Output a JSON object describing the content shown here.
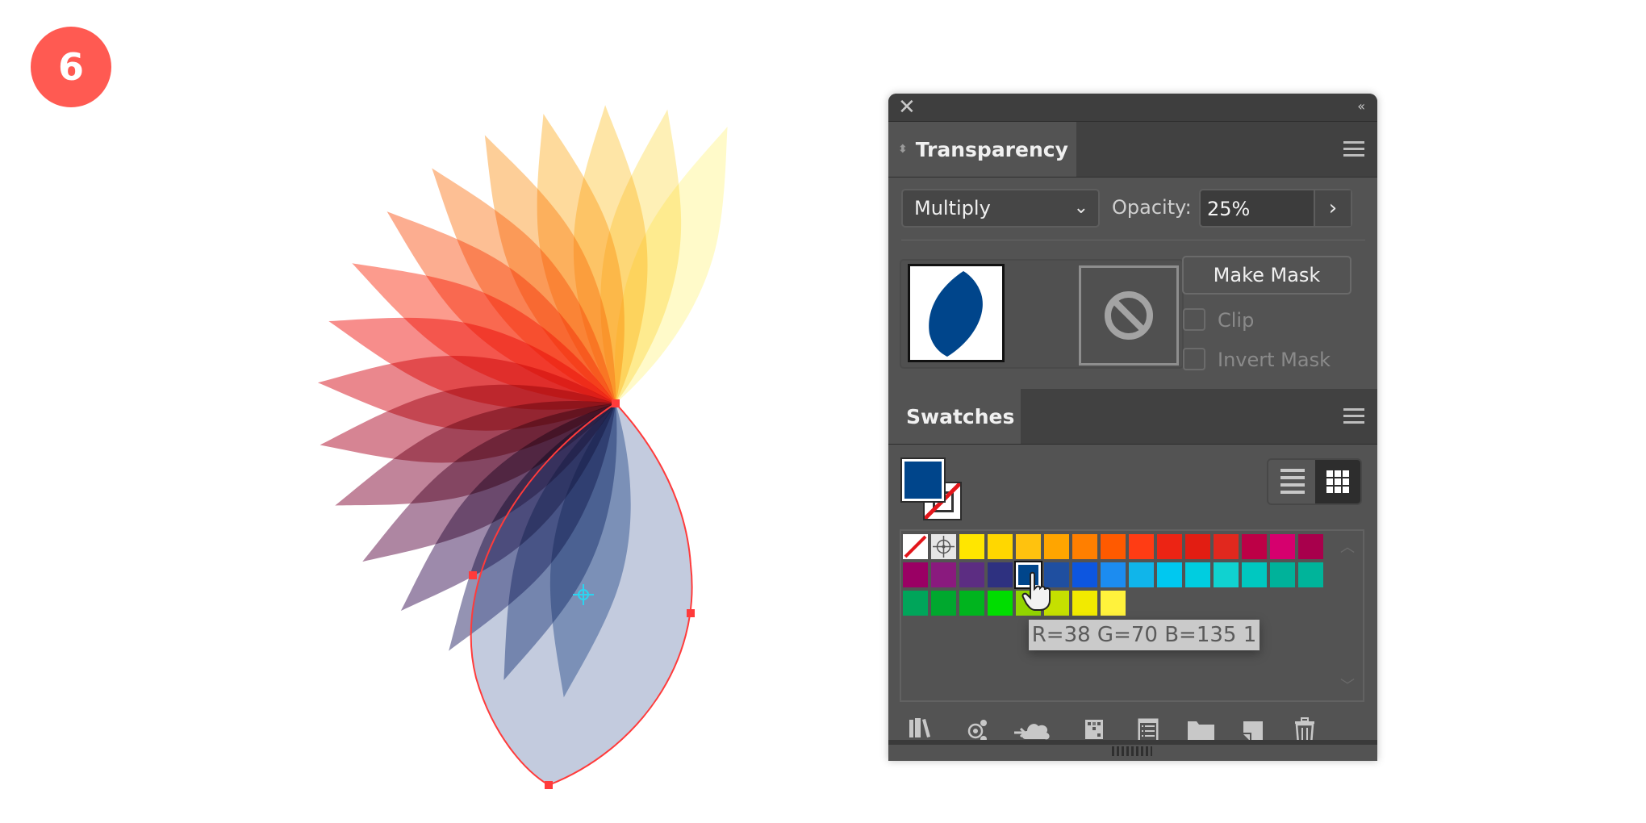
{
  "step_badge": "6",
  "artwork": {
    "petal_count": 17,
    "petal_colors": [
      "#fff59d",
      "#fde37a",
      "#fdd05c",
      "#fdbb4a",
      "#fca544",
      "#fb8a3d",
      "#fa6a35",
      "#f9482f",
      "#f0302b",
      "#d82430",
      "#b51f3a",
      "#8e1f47",
      "#6b2255",
      "#4d2a66",
      "#3d3a74",
      "#384f86",
      "#4a6c9e"
    ],
    "petal_opacity_percent": 25,
    "selected_petal_fill": "#26468a",
    "selection_color": "#ff3b3b",
    "center_point_color": "#2ad4f0"
  },
  "panel": {
    "close_icon": "close-x-icon",
    "collapse_icon": "double-chevron-left-icon",
    "transparency": {
      "tab_label": "Transparency",
      "blend_mode": "Multiply",
      "opacity_label": "Opacity:",
      "opacity_value": "25%",
      "make_mask_label": "Make Mask",
      "clip_label": "Clip",
      "clip_checked": false,
      "invert_mask_label": "Invert Mask",
      "invert_mask_checked": false,
      "thumbnail_fill": "#00458b"
    },
    "swatches": {
      "tab_label": "Swatches",
      "fill_color": "#00458b",
      "stroke": "none",
      "view_modes": [
        "list-view",
        "small-thumbnail-view"
      ],
      "active_view": "small-thumbnail-view",
      "rows": [
        [
          "none",
          "registration",
          "#ffe600",
          "#ffd700",
          "#ffc20e",
          "#ffa500",
          "#ff7f00",
          "#ff5a00",
          "#ff3c14",
          "#ec2414",
          "#e21d12",
          "#e1281e",
          "#bd0046",
          "#d6006e",
          "#a8004c"
        ],
        [
          "#9a0064",
          "#8a1a7e",
          "#5c2d82",
          "#2e3180",
          "#00458b",
          "#1f4fa0",
          "#0d56e0",
          "#1c8cf0",
          "#10b5ea",
          "#00c8f0",
          "#00cde0",
          "#10d2d0",
          "#00c8c0",
          "#00b29a",
          "#00b49a"
        ],
        [
          "#00a55a",
          "#00a82e",
          "#00b41e",
          "#00dd00",
          "#92d400",
          "#c5e000",
          "#f2ea00",
          "#fff23c"
        ]
      ],
      "selected_swatch": "#00458b",
      "tooltip": "R=38 G=70 B=135 1",
      "bottom_icons": [
        "swatch-libraries-icon",
        "show-kinds-icon",
        "add-to-library-icon",
        "swatch-options-grid-icon",
        "new-color-group-icon",
        "new-folder-icon",
        "new-swatch-icon",
        "delete-swatch-icon"
      ]
    }
  }
}
